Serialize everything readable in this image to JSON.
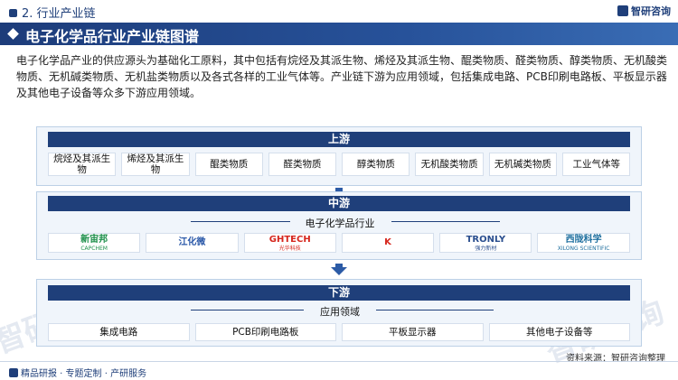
{
  "header": {
    "section": "2. 行业产业链",
    "brand": "智研咨询",
    "title": "电子化学品行业产业链图谱"
  },
  "intro": "电子化学品产业的供应源头为基础化工原料，其中包括有烷烃及其派生物、烯烃及其派生物、醌类物质、醛类物质、醇类物质、无机酸类物质、无机碱类物质、无机盐类物质以及各式各样的工业气体等。产业链下游为应用领域，包括集成电路、PCB印刷电路板、平板显示器及其他电子设备等众多下游应用领域。",
  "upstream": {
    "label": "上游",
    "items": [
      "烷烃及其派生物",
      "烯烃及其派生物",
      "醌类物质",
      "醛类物质",
      "醇类物质",
      "无机酸类物质",
      "无机碱类物质",
      "工业气体等"
    ]
  },
  "midstream": {
    "label": "中游",
    "industry": "电子化学品行业",
    "companies": [
      {
        "name": "新宙邦",
        "sub": "CAPCHEM",
        "color": "#1d8f4a"
      },
      {
        "name": "江化微",
        "sub": "",
        "color": "#2a58a8"
      },
      {
        "name": "GHTECH",
        "sub": "光华科技",
        "color": "#d6261d"
      },
      {
        "name": "K",
        "sub": "",
        "color": "#d6261d"
      },
      {
        "name": "TRONLY",
        "sub": "强力新材",
        "color": "#2b4f8f"
      },
      {
        "name": "西陇科学",
        "sub": "XILONG SCIENTIFIC",
        "color": "#1d6e9e"
      }
    ]
  },
  "downstream": {
    "label": "下游",
    "field": "应用领域",
    "items": [
      "集成电路",
      "PCB印刷电路板",
      "平板显示器",
      "其他电子设备等"
    ]
  },
  "source": "资料来源：智研咨询整理",
  "footer": "精品研报 · 专题定制 · 产研服务",
  "watermark": "智研咨询"
}
